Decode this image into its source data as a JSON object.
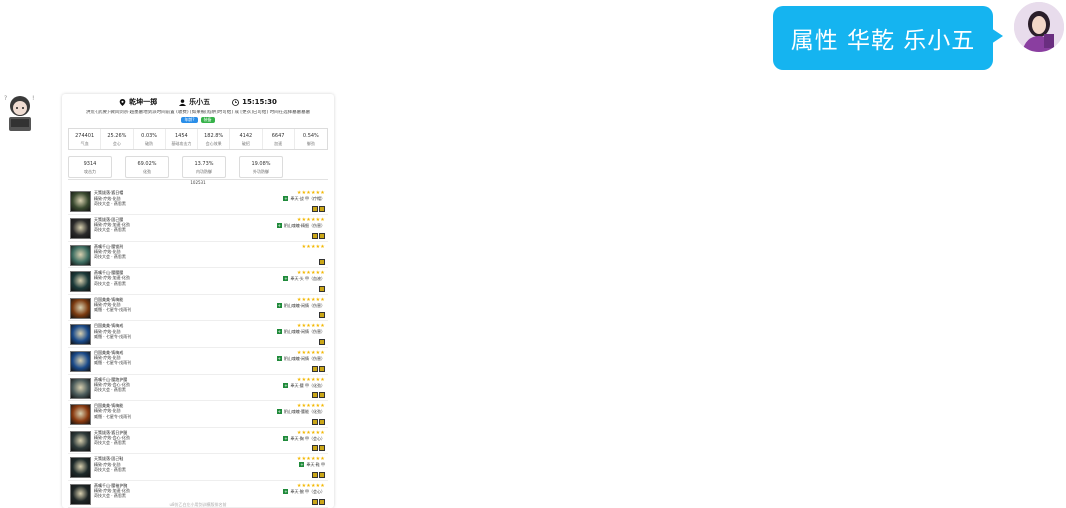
{
  "chat": {
    "user_message": "属性 华乾 乐小五"
  },
  "card": {
    "header": {
      "server": "乾坤一掷",
      "name": "乐小五",
      "time": "15:15:30"
    },
    "description": "洪荒·[武要]·微风剑宗·越墨墓地剑派时间前置 (收费) [如果被[陷阱]时可给]  或 [更衣]已可给]  时间在选择墓墓墓墓",
    "tags": [
      "年龄?",
      "装备"
    ],
    "stats": [
      {
        "value": "274401",
        "label": "气血"
      },
      {
        "value": "25.26%",
        "label": "会心"
      },
      {
        "value": "0.03%",
        "label": "破防"
      },
      {
        "value": "1454",
        "label": "基础攻击力"
      },
      {
        "value": "182.8%",
        "label": "会心效果"
      },
      {
        "value": "4142",
        "label": "破招"
      },
      {
        "value": "6647",
        "label": "加速"
      },
      {
        "value": "0.54%",
        "label": "御劲"
      }
    ],
    "stats2": [
      {
        "value": "9314",
        "label": "攻击力"
      },
      {
        "value": "69.02%",
        "label": "化劲"
      },
      {
        "value": "13.73%",
        "label": "内功防御"
      },
      {
        "value": "19.08%",
        "label": "外功防御"
      }
    ],
    "score": "102531",
    "equipment": [
      {
        "l1": "天策拔落·狐日帽",
        "l2": "精致·疗效·化劲",
        "l3": "奇技大会 · 燕思黑",
        "enh": "奉天·战 甲（疗帽）",
        "stars": "★★★★★★",
        "icon": "helmet-icon",
        "color": "#3a4a30"
      },
      {
        "l1": "天策拔落·固己腰",
        "l2": "精致·疗效·加速·化劲",
        "l3": "奇技大会 · 燕思黑",
        "enh": "阴山魂魄·精细（伤害）",
        "stars": "★★★★★★",
        "icon": "necklace-icon",
        "color": "#2a2a2a"
      },
      {
        "l1": "燕嘴千山·腰锁刑",
        "l2": "精致·疗效·化劲",
        "l3": "奇技大会 · 燕思黑",
        "enh": "",
        "stars": "★★★★★",
        "icon": "chest-armor-icon",
        "color": "#3e6e62"
      },
      {
        "l1": "燕嘴千山·腰腰腰",
        "l2": "精致·疗效·加速·化劲",
        "l3": "奇技大会 · 燕思黑",
        "enh": "奉天·头 甲（血液）",
        "stars": "★★★★★★",
        "icon": "shoulder-armor-icon",
        "color": "#1c3a3a"
      },
      {
        "l1": "目国美美·铸梅能",
        "l2": "精致·疗效·化劲",
        "l3": "威慑 · 七星令·戌雨刊",
        "enh": "阴山魂魄·闲情（伤害）",
        "stars": "★★★★★★",
        "icon": "belt-icon",
        "color": "#7a3a10"
      },
      {
        "l1": "目国美美·铸梅戒",
        "l2": "精致·疗效·化劲",
        "l3": "威慑 · 七星令·戌雨刊",
        "enh": "阴山魂魄·闲情（伤害）",
        "stars": "★★★★★★",
        "icon": "ring-icon",
        "color": "#1a4a8a"
      },
      {
        "l1": "目国美美·铸梅戒",
        "l2": "精致·疗效·化劲",
        "l3": "威慑 · 七星令·戌雨刊",
        "enh": "阴山魂魄·闲情（伤害）",
        "stars": "★★★★★★",
        "icon": "ring-icon",
        "color": "#1a4a8a"
      },
      {
        "l1": "燕嘴千山·腰跑护腰",
        "l2": "精致·疗效·会心·化劲",
        "l3": "奇技大会 · 燕思黑",
        "enh": "奉天·腰 甲（化劲）",
        "stars": "★★★★★★",
        "icon": "waist-armor-icon",
        "color": "#4a5a5a"
      },
      {
        "l1": "目国美美·铸梅能",
        "l2": "精致·疗效·化劲",
        "l3": "威慑 · 七星令·戌雨刊",
        "enh": "阴山魂魄·腰能（化劲）",
        "stars": "★★★★★★",
        "icon": "amulet-icon",
        "color": "#8a3a10"
      },
      {
        "l1": "天策拔落·狐日护腿",
        "l2": "精致·疗效·会心·化劲",
        "l3": "奇技大会 · 燕思黑",
        "enh": "奉天·胸 甲（会心）",
        "stars": "★★★★★★",
        "icon": "pants-icon",
        "color": "#2e3a3a"
      },
      {
        "l1": "天策拔落·固己鞋",
        "l2": "精致·疗效·化劲",
        "l3": "奇技大会 · 燕思黑",
        "enh": "奉天·鞋 甲",
        "stars": "★★★★★★",
        "icon": "boots-icon",
        "color": "#1e2a2a"
      },
      {
        "l1": "燕嘴千山·腰袖护腕",
        "l2": "精致·疗效·加速·化劲",
        "l3": "奇技大会 · 燕思黑",
        "enh": "奉天·腕 甲（会心）",
        "stars": "★★★★★★",
        "icon": "bracer-icon",
        "color": "#1e2626"
      }
    ],
    "footer": "u8仿乙白左小用剑训模版排名前"
  }
}
